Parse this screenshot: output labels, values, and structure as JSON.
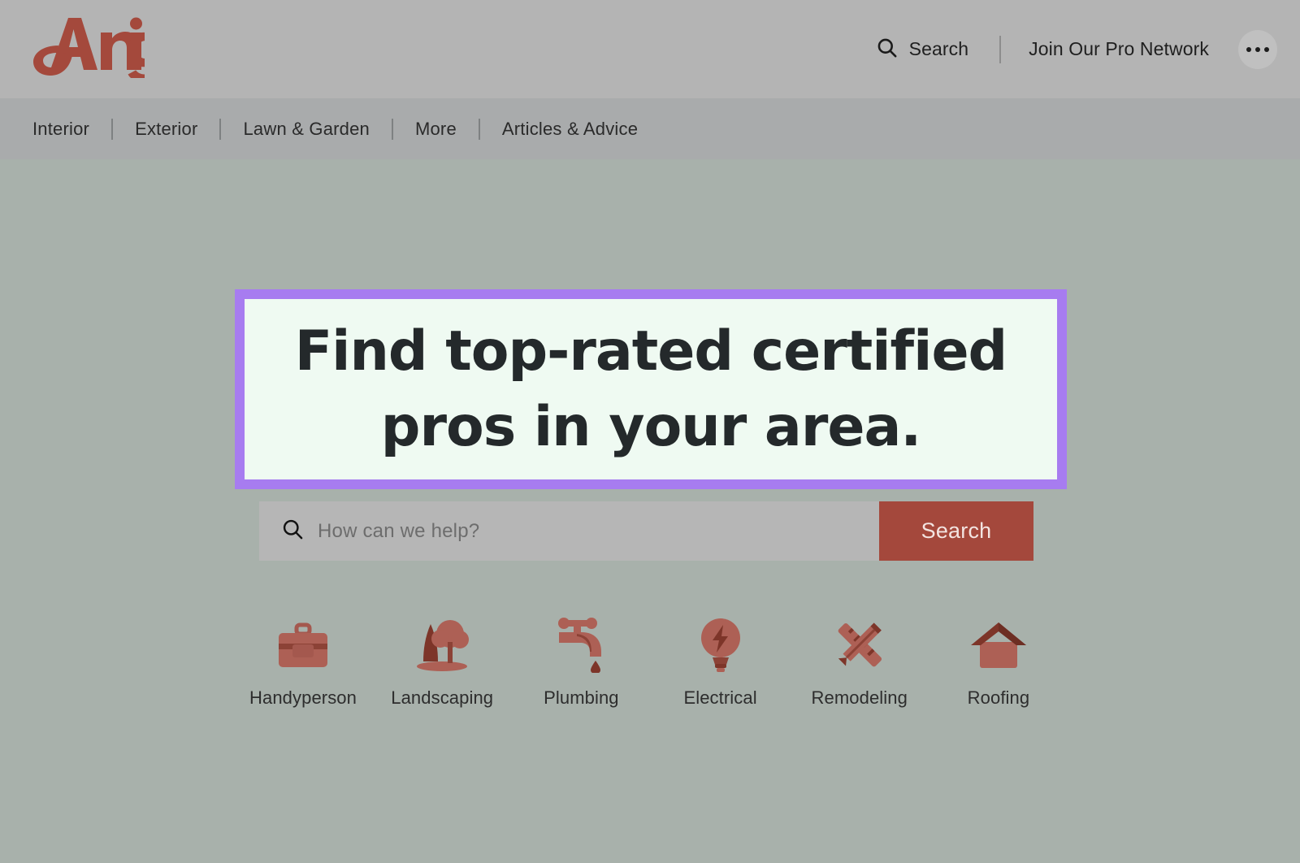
{
  "site": {
    "brand": "Angi",
    "brand_color": "#a4493c"
  },
  "header": {
    "search_label": "Search",
    "search_icon": "search-icon",
    "pro_network_label": "Join Our Pro Network",
    "more_icon": "ellipsis-icon"
  },
  "nav": {
    "items": [
      {
        "label": "Interior"
      },
      {
        "label": "Exterior"
      },
      {
        "label": "Lawn & Garden"
      },
      {
        "label": "More"
      },
      {
        "label": "Articles & Advice"
      }
    ]
  },
  "hero": {
    "headline_line1": "Find top-rated certified",
    "headline_line2": "pros in your area.",
    "highlight_border_color": "#a77cf0",
    "highlight_background_color": "#effaf2",
    "search": {
      "placeholder": "How can we help?",
      "value": "",
      "icon": "search-icon",
      "button_label": "Search",
      "button_color": "#a4483c"
    },
    "categories": [
      {
        "label": "Handyperson",
        "icon": "toolbox-icon"
      },
      {
        "label": "Landscaping",
        "icon": "trees-icon"
      },
      {
        "label": "Plumbing",
        "icon": "faucet-icon"
      },
      {
        "label": "Electrical",
        "icon": "lightbulb-bolt-icon"
      },
      {
        "label": "Remodeling",
        "icon": "ruler-pencil-cross-icon"
      },
      {
        "label": "Roofing",
        "icon": "house-roof-icon"
      }
    ]
  }
}
